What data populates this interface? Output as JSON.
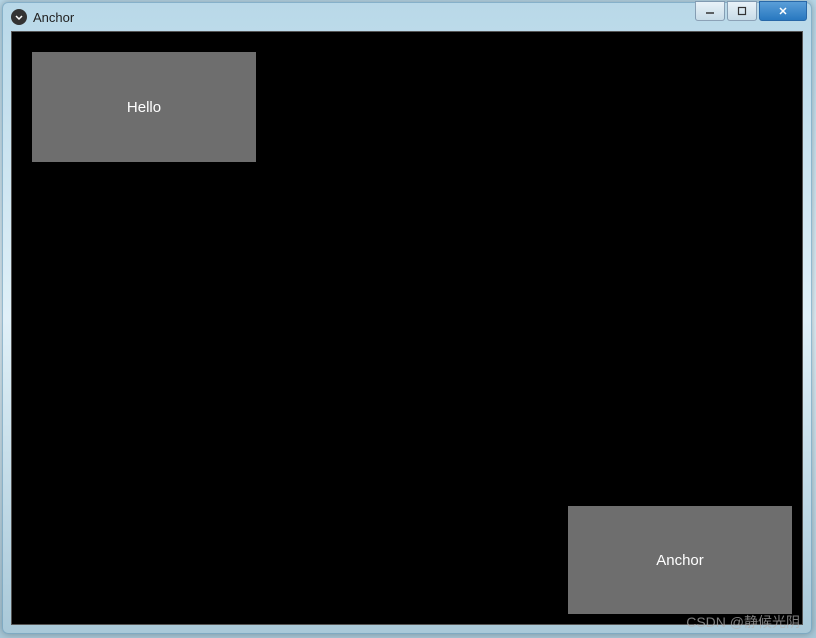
{
  "window": {
    "title": "Anchor"
  },
  "buttons": {
    "hello_label": "Hello",
    "anchor_label": "Anchor"
  },
  "watermark": {
    "text": "CSDN @静候光阴"
  }
}
